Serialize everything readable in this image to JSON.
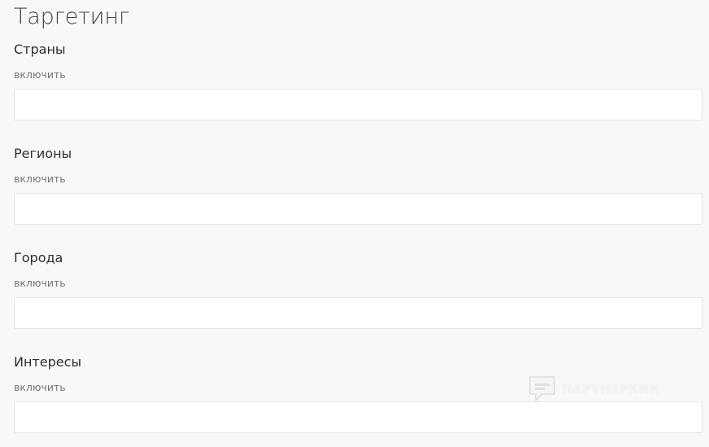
{
  "page": {
    "title": "Таргетинг"
  },
  "sections": [
    {
      "title": "Страны",
      "include_label": "включить",
      "input_value": ""
    },
    {
      "title": "Регионы",
      "include_label": "включить",
      "input_value": ""
    },
    {
      "title": "Города",
      "include_label": "включить",
      "input_value": ""
    },
    {
      "title": "Интересы",
      "include_label": "включить",
      "input_value": ""
    }
  ],
  "watermark": {
    "text": "ПАРТНЕРКИН",
    "icon": "chat-bubble-icon"
  }
}
